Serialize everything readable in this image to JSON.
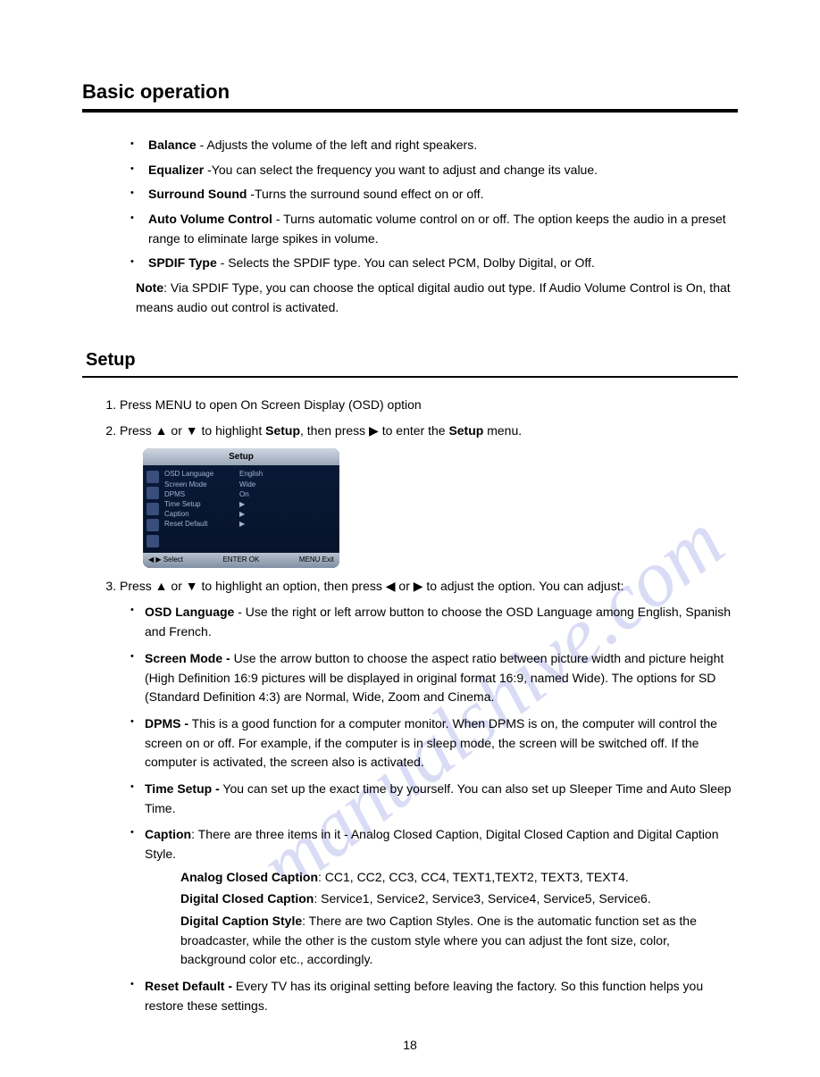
{
  "page_title": "Basic operation",
  "audio": {
    "balance": {
      "term": "Balance",
      "desc": " - Adjusts the volume of the left and right speakers."
    },
    "equalizer": {
      "term": "Equalizer",
      "desc": " -You can select the frequency you want to adjust and change its value."
    },
    "surround": {
      "term": "Surround Sound",
      "desc": " -Turns the surround sound effect on or off."
    },
    "avc": {
      "term": "Auto Volume Control",
      "desc": " - Turns automatic volume control on or off. The option keeps the audio in a preset range to eliminate large spikes in volume."
    },
    "spdif": {
      "term": "SPDIF Type",
      "desc": " -  Selects the SPDIF type. You can select PCM, Dolby Digital, or Off."
    }
  },
  "note": {
    "label": "Note",
    "text": ": Via SPDIF Type, you can choose the optical digital audio out type. If Audio Volume  Control is On, that means audio out control is activated."
  },
  "section_setup": "Setup",
  "steps": {
    "s1": "Press MENU to open On Screen Display (OSD) option",
    "s2a": "Press ▲ or ▼ to highlight ",
    "s2b": "Setup",
    "s2c": ", then press ▶ to enter the ",
    "s2d": "Setup",
    "s2e": " menu.",
    "s3": "Press ▲ or ▼ to highlight an option, then press ◀ or ▶ to adjust the option. You can adjust:"
  },
  "osd": {
    "title": "Setup",
    "rows": [
      {
        "label": "OSD Language",
        "value": "English"
      },
      {
        "label": "Screen Mode",
        "value": "Wide"
      },
      {
        "label": "DPMS",
        "value": "On"
      },
      {
        "label": "Time Setup",
        "value": "▶"
      },
      {
        "label": "Caption",
        "value": "▶"
      },
      {
        "label": "Reset Default",
        "value": "▶"
      }
    ],
    "foot_left": "◀ ▶ Select",
    "foot_mid": "ENTER OK",
    "foot_right": "MENU Exit"
  },
  "setup_items": {
    "osd_lang": {
      "term": "OSD Language",
      "desc": " - Use the right or left arrow button to choose the OSD Language among English, Spanish and French."
    },
    "screen_mode": {
      "term": "Screen Mode -",
      "desc": " Use the arrow button to choose the aspect ratio between picture width and picture height (High Definition 16:9 pictures will be displayed in original format 16:9, named Wide). The options for SD (Standard Definition 4:3) are Normal, Wide, Zoom and Cinema."
    },
    "dpms": {
      "term": "DPMS -",
      "desc": " This is a good function for a computer monitor. When DPMS is on, the computer will control the screen on or off. For example, if the computer is in sleep mode, the screen will be switched off. If the computer is activated, the screen also is activated."
    },
    "time_setup": {
      "term": "Time Setup -",
      "desc": " You can set up the exact time by yourself. You can also set up Sleeper Time and Auto Sleep Time."
    },
    "caption": {
      "term": "Caption",
      "desc": ": There are three items in it - Analog Closed Caption, Digital Closed Caption and Digital Caption Style."
    },
    "reset": {
      "term": "Reset Default -",
      "desc": "  Every TV has its original setting before leaving the factory. So this function helps you restore these settings."
    }
  },
  "caption_sub": {
    "analog": {
      "term": "Analog Closed Caption",
      "desc": ": CC1, CC2, CC3, CC4, TEXT1,TEXT2, TEXT3, TEXT4."
    },
    "digital": {
      "term": "Digital Closed Caption",
      "desc": ": Service1, Service2, Service3, Service4, Service5, Service6."
    },
    "style": {
      "term": "Digital Caption Style",
      "desc": ": There are two Caption Styles. One is the automatic function set as the broadcaster, while the other is the custom style where you can adjust the font size, color,  background color etc., accordingly."
    }
  },
  "page_number": "18",
  "watermark": "manualshive.com"
}
